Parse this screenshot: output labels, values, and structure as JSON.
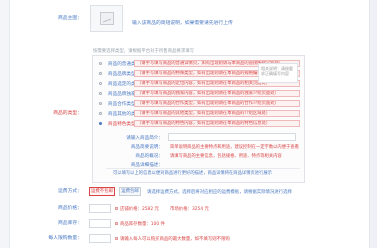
{
  "product_pic": {
    "label": "商品主图：",
    "hint": "输入该商品的简短说明，如果需要请先进行上传"
  },
  "intro_line": "按需要选择类型，请根据平台对于所售商品要求填写",
  "product_type": {
    "label": "商品的类型：",
    "options": [
      {
        "name": "商品的普通类型",
        "desc": "（请手写填写商品的普通详情页，如有出现则请与本商品的直接编辑介绍处）"
      },
      {
        "name": "商品品牌类型",
        "desc": "（请手写填写商品的特殊类型，如有出现则请在本商品的规格编辑页面处）"
      },
      {
        "name": "商品选定的类型",
        "desc": "（请手写填写商品的定位内容，如有出现则请在本商品的相关页面处）"
      },
      {
        "name": "商品品牌独家",
        "desc": "（请手写填写商品的独家内容，如有出现则请在本商品的独家介绍页面处）"
      },
      {
        "name": "商品合作类型",
        "desc": "（请手写填写商品的合作类型，如有出现则请在本商品的合作介绍页面处）"
      },
      {
        "name": "商品其他的类型",
        "desc": "（请手写填写商品的其他类型，如有出现则请在本商品的介绍区域处）"
      },
      {
        "name": "商品特色类型",
        "desc": "（请手写填写商品的特色内容，如有出现则请在本商品的特色信息处）"
      }
    ],
    "fields": [
      {
        "label": "请输入商品简介：",
        "note": ""
      },
      {
        "label": "商品简要说明：",
        "note": "简单说明商品的主要特点和用途，建议控制在一定字数以内便于查看"
      },
      {
        "label": "商品的概况：",
        "note": "请填写商品的主要信息，包括规格、用途、特点等相关内容"
      },
      {
        "label": "商品详细描述：",
        "note": ""
      }
    ],
    "footer": "可以填写以上的信息以便对商品进行更好的描述，商品详情将在商品详情页进行展示",
    "bubble": "相关说明：请按要求正确填写内容"
  },
  "shipping": {
    "label": "运费方式：",
    "buttons": [
      "运费不包邮",
      "运费包邮"
    ],
    "help": "请选择运费方式，选择后将对应相应的运费模板，请根据实际情况进行选择"
  },
  "price": {
    "label": "商品价格：",
    "note": "店铺价格：2582 元",
    "help": "市场价格：3254 元"
  },
  "stock": {
    "label": "商品库存：",
    "note": "商品库存数量：100 件"
  },
  "purchase_limit": {
    "label": "每人限购数量：",
    "help": "请输入每人可以购买商品的最大数量，如不填写则不限购"
  }
}
